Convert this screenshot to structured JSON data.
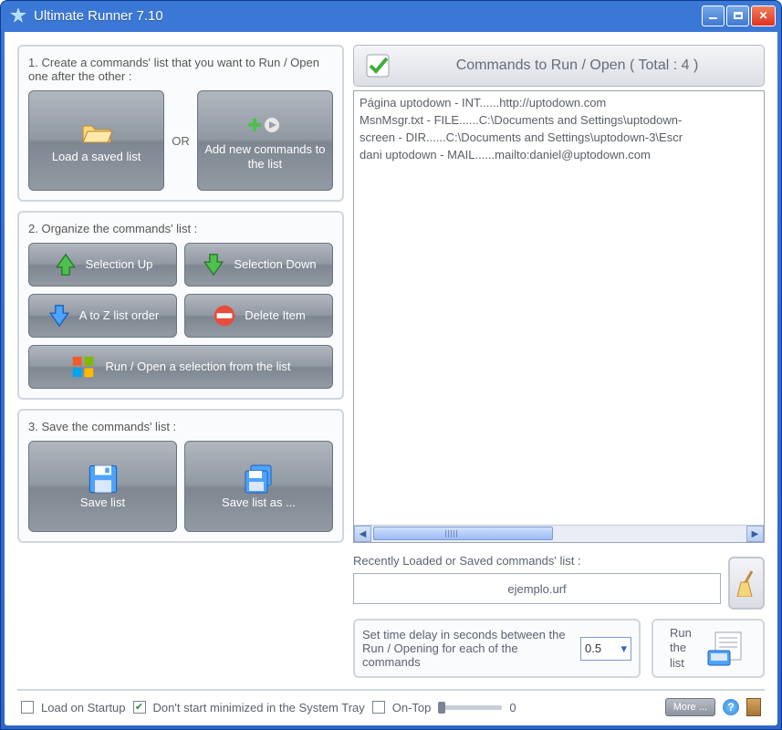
{
  "title": "Ultimate Runner 7.10",
  "step1": {
    "title": "1. Create a commands' list that  you want to Run / Open one after the other :",
    "load_label": "Load a saved list",
    "or": "OR",
    "add_label": "Add new commands to the list"
  },
  "step2": {
    "title": "2. Organize the commands' list :",
    "sel_up": "Selection Up",
    "sel_down": "Selection Down",
    "a2z": "A to Z list order",
    "delete": "Delete Item",
    "run_sel": "Run / Open a  selection from the list"
  },
  "step3": {
    "title": "3. Save the commands' list :",
    "save": "Save list",
    "saveas": "Save list as ..."
  },
  "cmds": {
    "header": "Commands to Run / Open ( Total : 4 )",
    "items": [
      "Página uptodown - INT......http://uptodown.com",
      "MsnMsgr.txt - FILE......C:\\Documents and Settings\\uptodown-",
      "screen - DIR......C:\\Documents and Settings\\uptodown-3\\Escr",
      "dani uptodown - MAIL......mailto:daniel@uptodown.com"
    ]
  },
  "recent": {
    "label": "Recently Loaded or Saved commands' list :",
    "value": "ejemplo.urf"
  },
  "delay": {
    "text": "Set time delay in seconds between the Run / Opening for each  of the commands",
    "value": "0.5"
  },
  "run": {
    "label": "Run the list"
  },
  "footer": {
    "load_startup": "Load on Startup",
    "no_min_tray": "Don't start minimized in the System Tray",
    "on_top": "On-Top",
    "opacity_val": "0",
    "more": "More ..."
  }
}
